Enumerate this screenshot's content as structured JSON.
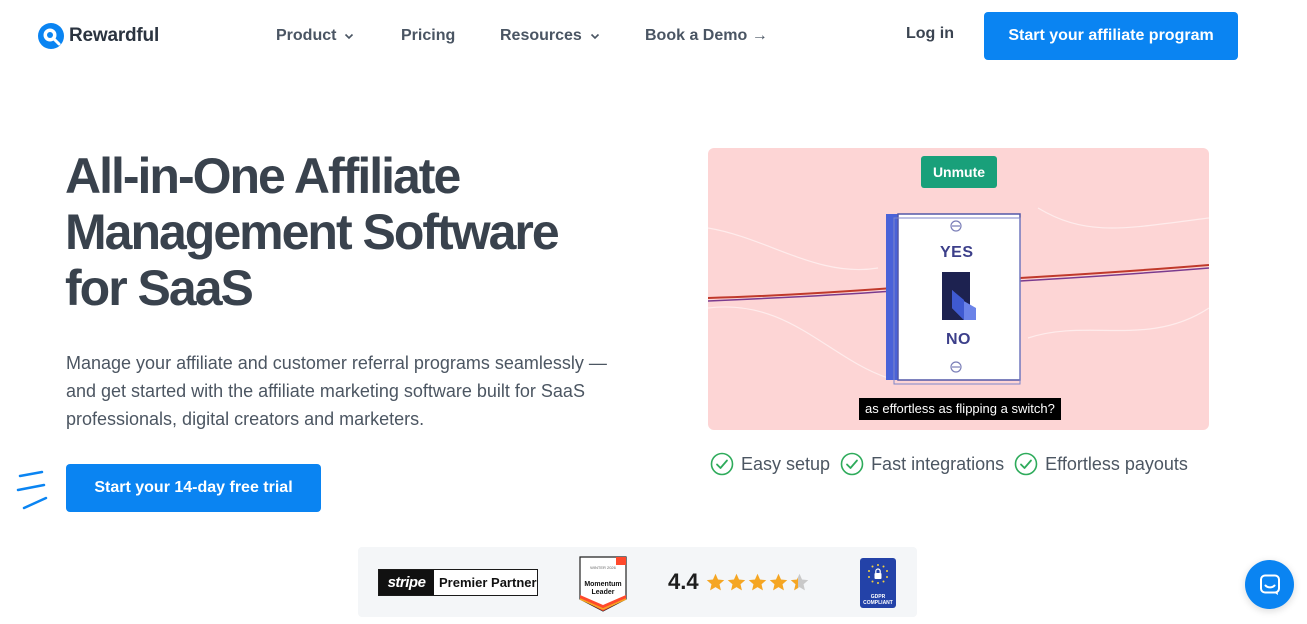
{
  "brand": {
    "name": "Rewardful",
    "accent": "#0a84f2"
  },
  "nav": {
    "items": [
      {
        "label": "Product",
        "dropdown": true
      },
      {
        "label": "Pricing",
        "dropdown": false
      },
      {
        "label": "Resources",
        "dropdown": true
      },
      {
        "label": "Book a Demo →",
        "dropdown": false
      }
    ],
    "login": "Log in",
    "cta": "Start your affiliate program"
  },
  "hero": {
    "title": "All-in-One Affiliate Management Software for SaaS",
    "subtitle": "Manage your affiliate and customer referral programs seamlessly — and get started with the affiliate marketing software built for SaaS professionals, digital creators and marketers.",
    "cta": "Start your 14-day free trial"
  },
  "video": {
    "unmute_label": "Unmute",
    "switch_yes": "YES",
    "switch_no": "NO",
    "caption": "as effortless as flipping a switch?",
    "bg_color": "#fdd5d5"
  },
  "features": [
    "Easy setup",
    "Fast integrations",
    "Effortless payouts"
  ],
  "badges": {
    "stripe_logo": "stripe",
    "stripe_label": "Premier Partner",
    "g2_season": "WINTER 2026",
    "g2_title": "Momentum Leader",
    "rating": "4.4",
    "rating_stars": 4.4,
    "gdpr_label": "GDPR COMPLIANT"
  },
  "chat": {
    "icon": "chat-icon"
  }
}
